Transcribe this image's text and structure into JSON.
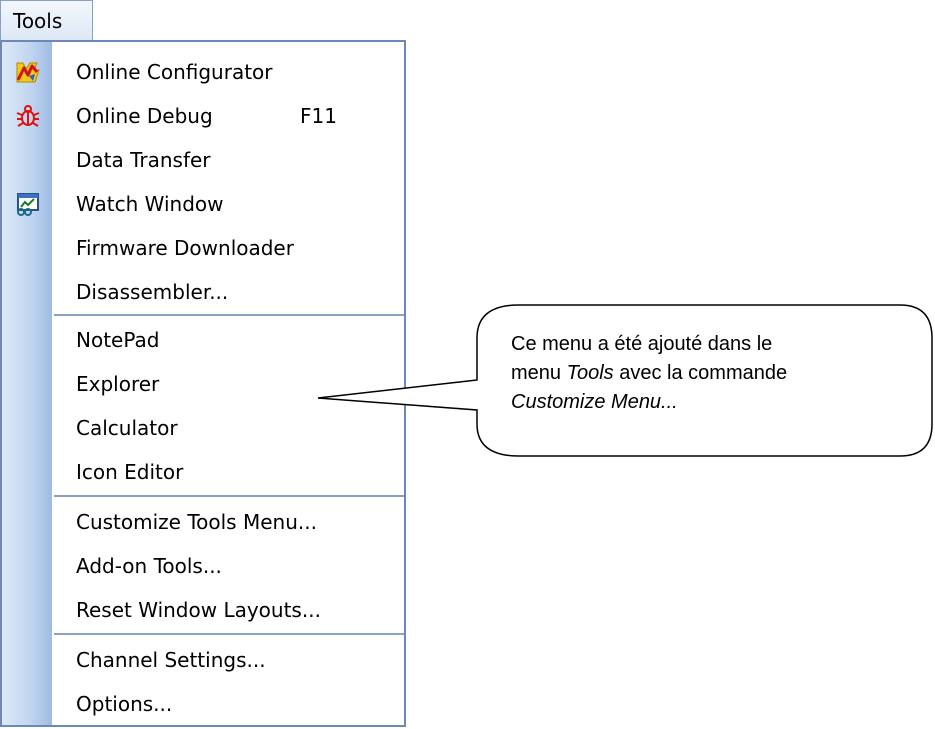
{
  "menubar": {
    "tab_label": "Tools"
  },
  "menu": {
    "items": [
      {
        "label": "Online Configurator",
        "shortcut": "",
        "icon": "online-configurator-icon"
      },
      {
        "label": "Online Debug",
        "shortcut": "F11",
        "icon": "bug-icon"
      },
      {
        "label": "Data Transfer",
        "shortcut": "",
        "icon": ""
      },
      {
        "label": "Watch Window",
        "shortcut": "",
        "icon": "watch-window-icon"
      },
      {
        "label": "Firmware Downloader",
        "shortcut": "",
        "icon": ""
      },
      {
        "label": "Disassembler...",
        "shortcut": "",
        "icon": ""
      },
      {
        "label": "NotePad",
        "shortcut": "",
        "icon": ""
      },
      {
        "label": "Explorer",
        "shortcut": "",
        "icon": ""
      },
      {
        "label": "Calculator",
        "shortcut": "",
        "icon": ""
      },
      {
        "label": "Icon Editor",
        "shortcut": "",
        "icon": ""
      },
      {
        "label": "Customize Tools Menu...",
        "shortcut": "",
        "icon": ""
      },
      {
        "label": "Add-on Tools...",
        "shortcut": "",
        "icon": ""
      },
      {
        "label": "Reset Window Layouts...",
        "shortcut": "",
        "icon": ""
      },
      {
        "label": "Channel Settings...",
        "shortcut": "",
        "icon": ""
      },
      {
        "label": "Options...",
        "shortcut": "",
        "icon": ""
      }
    ]
  },
  "callout": {
    "line1": "Ce menu a été ajouté dans le",
    "line2_prefix": "menu ",
    "line2_emph": "Tools",
    "line2_suffix": " avec la commande",
    "line3_emph": "Customize Menu..."
  },
  "colors": {
    "menu_border": "#6b88b6",
    "gutter": "#c2d6f0",
    "separator": "#8aa2c8"
  }
}
